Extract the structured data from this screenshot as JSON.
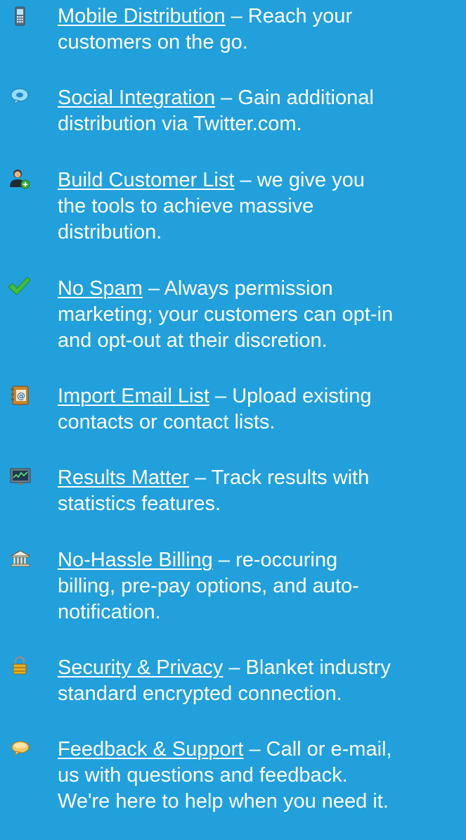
{
  "features": [
    {
      "icon": "mobile-phone-icon",
      "title": "Mobile Distribution",
      "separator": " – ",
      "line1_rest": "Reach your",
      "lines": [
        "customers on the go."
      ]
    },
    {
      "icon": "chat-bubble-icon",
      "title": "Social Integration",
      "separator": " – ",
      "line1_rest": "Gain additional",
      "lines": [
        "distribution via Twitter.com."
      ]
    },
    {
      "icon": "user-add-icon",
      "title": "Build Customer List",
      "separator": " – ",
      "line1_rest": "we give you",
      "lines": [
        "the tools to achieve massive",
        "distribution."
      ]
    },
    {
      "icon": "checkmark-icon",
      "title": "No Spam",
      "separator": " – ",
      "line1_rest": "Always permission",
      "lines": [
        "marketing; your customers can opt-in",
        "and opt-out at their discretion."
      ]
    },
    {
      "icon": "address-book-icon",
      "title": "Import Email List",
      "separator": " – ",
      "line1_rest": "Upload existing",
      "lines": [
        "contacts or contact lists."
      ]
    },
    {
      "icon": "statistics-monitor-icon",
      "title": "Results Matter",
      "separator": " – ",
      "line1_rest": "Track results with",
      "lines": [
        "statistics features."
      ]
    },
    {
      "icon": "bank-icon",
      "title": "No-Hassle Billing",
      "separator": " – ",
      "line1_rest": "re-occuring",
      "lines": [
        "billing, pre-pay options, and auto-",
        "notification."
      ]
    },
    {
      "icon": "padlock-icon",
      "title": "Security & Privacy",
      "separator": " – ",
      "line1_rest": "Blanket industry",
      "lines": [
        "standard encrypted connection."
      ]
    },
    {
      "icon": "speech-bubble-icon",
      "title": "Feedback & Support",
      "separator": " – ",
      "line1_rest": "Call or e-mail,",
      "lines": [
        "us with questions and feedback.",
        "We're here to help when you need it."
      ]
    }
  ]
}
